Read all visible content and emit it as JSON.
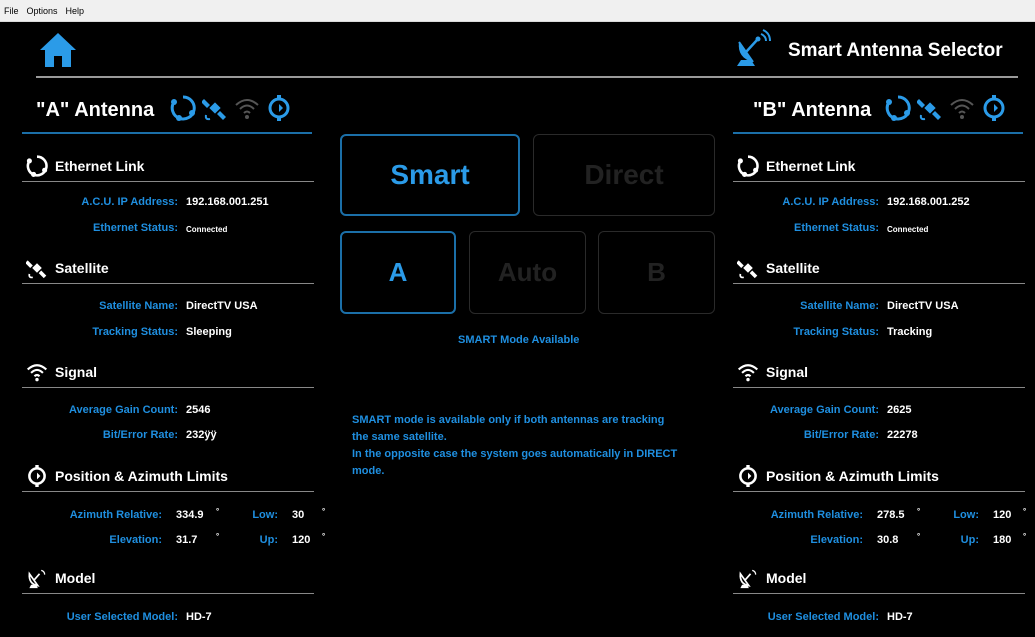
{
  "menu": [
    "File",
    "Options",
    "Help"
  ],
  "header": {
    "title": "Smart Antenna Selector",
    "home_icon": "home-icon",
    "title_icon": "satellite-dish-icon"
  },
  "antennas": [
    {
      "title": "\"A\" Antenna",
      "ethernet": {
        "title": "Ethernet Link",
        "ip_label": "A.C.U. IP Address:",
        "ip": "192.168.001.251",
        "status_label": "Ethernet Status:",
        "status": "Connected"
      },
      "satellite": {
        "title": "Satellite",
        "name_label": "Satellite Name:",
        "name": "DirectTV USA",
        "tracking_label": "Tracking Status:",
        "tracking": "Sleeping"
      },
      "signal": {
        "title": "Signal",
        "gain_label": "Average Gain Count:",
        "gain": "2546",
        "ber_label": "Bit/Error Rate:",
        "ber": "232ÿÿ"
      },
      "position": {
        "title": "Position & Azimuth Limits",
        "az_label": "Azimuth Relative:",
        "az": "334.9",
        "low_label": "Low:",
        "low": "30",
        "el_label": "Elevation:",
        "el": "31.7",
        "up_label": "Up:",
        "up": "120",
        "deg": "°"
      },
      "model": {
        "title": "Model",
        "label": "User Selected Model:",
        "value": "HD-7"
      }
    },
    {
      "title": "\"B\" Antenna",
      "ethernet": {
        "title": "Ethernet Link",
        "ip_label": "A.C.U. IP Address:",
        "ip": "192.168.001.252",
        "status_label": "Ethernet Status:",
        "status": "Connected"
      },
      "satellite": {
        "title": "Satellite",
        "name_label": "Satellite Name:",
        "name": "DirectTV USA",
        "tracking_label": "Tracking Status:",
        "tracking": "Tracking"
      },
      "signal": {
        "title": "Signal",
        "gain_label": "Average Gain Count:",
        "gain": "2625",
        "ber_label": "Bit/Error Rate:",
        "ber": "22278"
      },
      "position": {
        "title": "Position & Azimuth Limits",
        "az_label": "Azimuth Relative:",
        "az": "278.5",
        "low_label": "Low:",
        "low": "120",
        "el_label": "Elevation:",
        "el": "30.8",
        "up_label": "Up:",
        "up": "180",
        "deg": "°"
      },
      "model": {
        "title": "Model",
        "label": "User Selected Model:",
        "value": "HD-7"
      }
    }
  ],
  "controls": {
    "smart": "Smart",
    "direct": "Direct",
    "a": "A",
    "auto": "Auto",
    "b": "B",
    "status": "SMART Mode Available",
    "info_line1": "SMART mode is available only if both antennas are tracking",
    "info_line2": "the same satellite.",
    "info_line3": "In the opposite case the system goes automatically in DIRECT",
    "info_line4": "mode."
  },
  "colors": {
    "accent": "#1f8fe0",
    "active_border": "#1b6fa8",
    "background": "#000000"
  }
}
